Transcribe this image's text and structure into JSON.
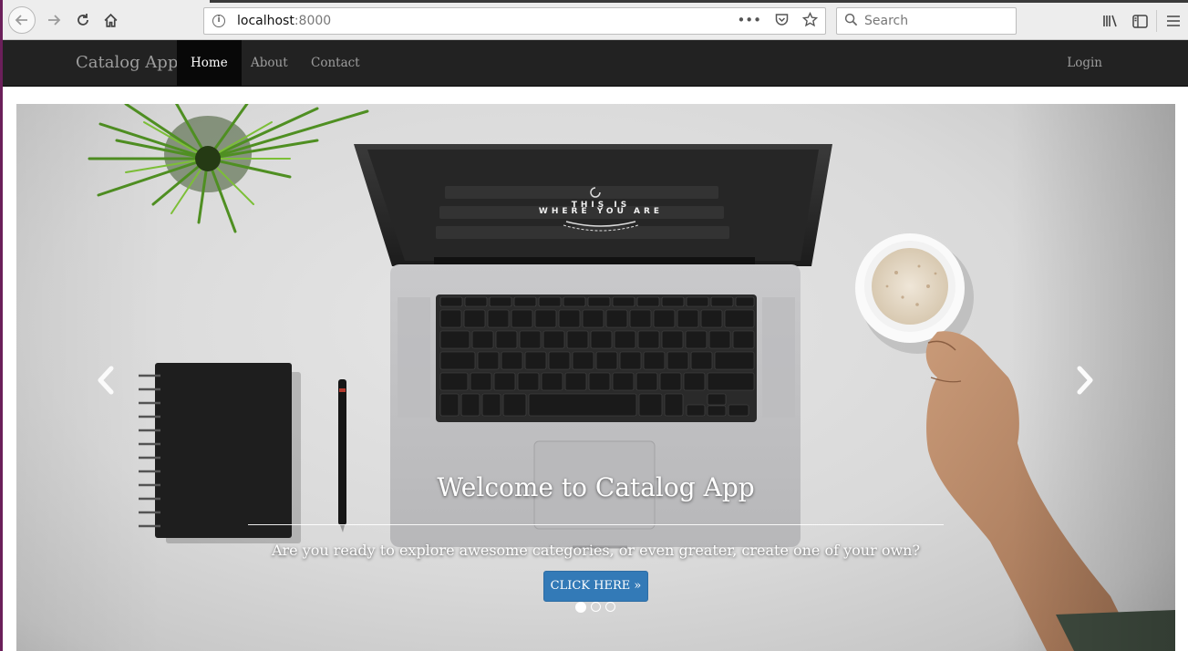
{
  "browser": {
    "url_host": "localhost",
    "url_port": ":8000",
    "search_placeholder": "Search"
  },
  "navbar": {
    "brand": "Catalog App",
    "items": [
      {
        "label": "Home",
        "active": true
      },
      {
        "label": "About",
        "active": false
      },
      {
        "label": "Contact",
        "active": false
      }
    ],
    "login": "Login"
  },
  "hero": {
    "screen_line1": "THIS IS",
    "screen_line2": "WHERE YOU ARE",
    "title": "Welcome to Catalog App",
    "text": "Are you ready to explore awesome categories, or even greater, create one of your own?",
    "button": "CLICK HERE »",
    "slide_count": 3,
    "active_slide": 1
  },
  "icons": [
    "back-icon",
    "forward-icon",
    "reload-icon",
    "home-icon",
    "info-icon",
    "more-icon",
    "pocket-icon",
    "bookmark-star-icon",
    "search-icon",
    "library-icon",
    "sidebar-icon",
    "menu-icon",
    "chevron-left-icon",
    "chevron-right-icon"
  ]
}
